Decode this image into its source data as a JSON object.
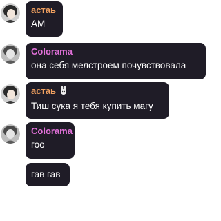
{
  "colors": {
    "bubble": "#1f1c27",
    "name_orange": "#f0a060",
    "name_pink": "#e070d8",
    "text": "#ffffff"
  },
  "messages": [
    {
      "author": "астаь",
      "author_color": "#f0a060",
      "avatar_icon": "user-avatar-dark-hair",
      "text": "АМ"
    },
    {
      "author": "Colorama",
      "author_color": "#e070d8",
      "avatar_icon": "user-avatar-grayscale",
      "text": "она себя мелстроем почувствовала"
    },
    {
      "author": "астаь",
      "author_color": "#f0a060",
      "avatar_icon": "user-avatar-dark-hair",
      "badge_icon": "bunny-badge-icon",
      "text": "Тиш сука я тебя купить магу"
    },
    {
      "author": "Colorama",
      "author_color": "#e070d8",
      "avatar_icon": "user-avatar-grayscale",
      "text": "гоо"
    },
    {
      "author": "Colorama",
      "author_color": "#e070d8",
      "text": "гав гав"
    }
  ]
}
